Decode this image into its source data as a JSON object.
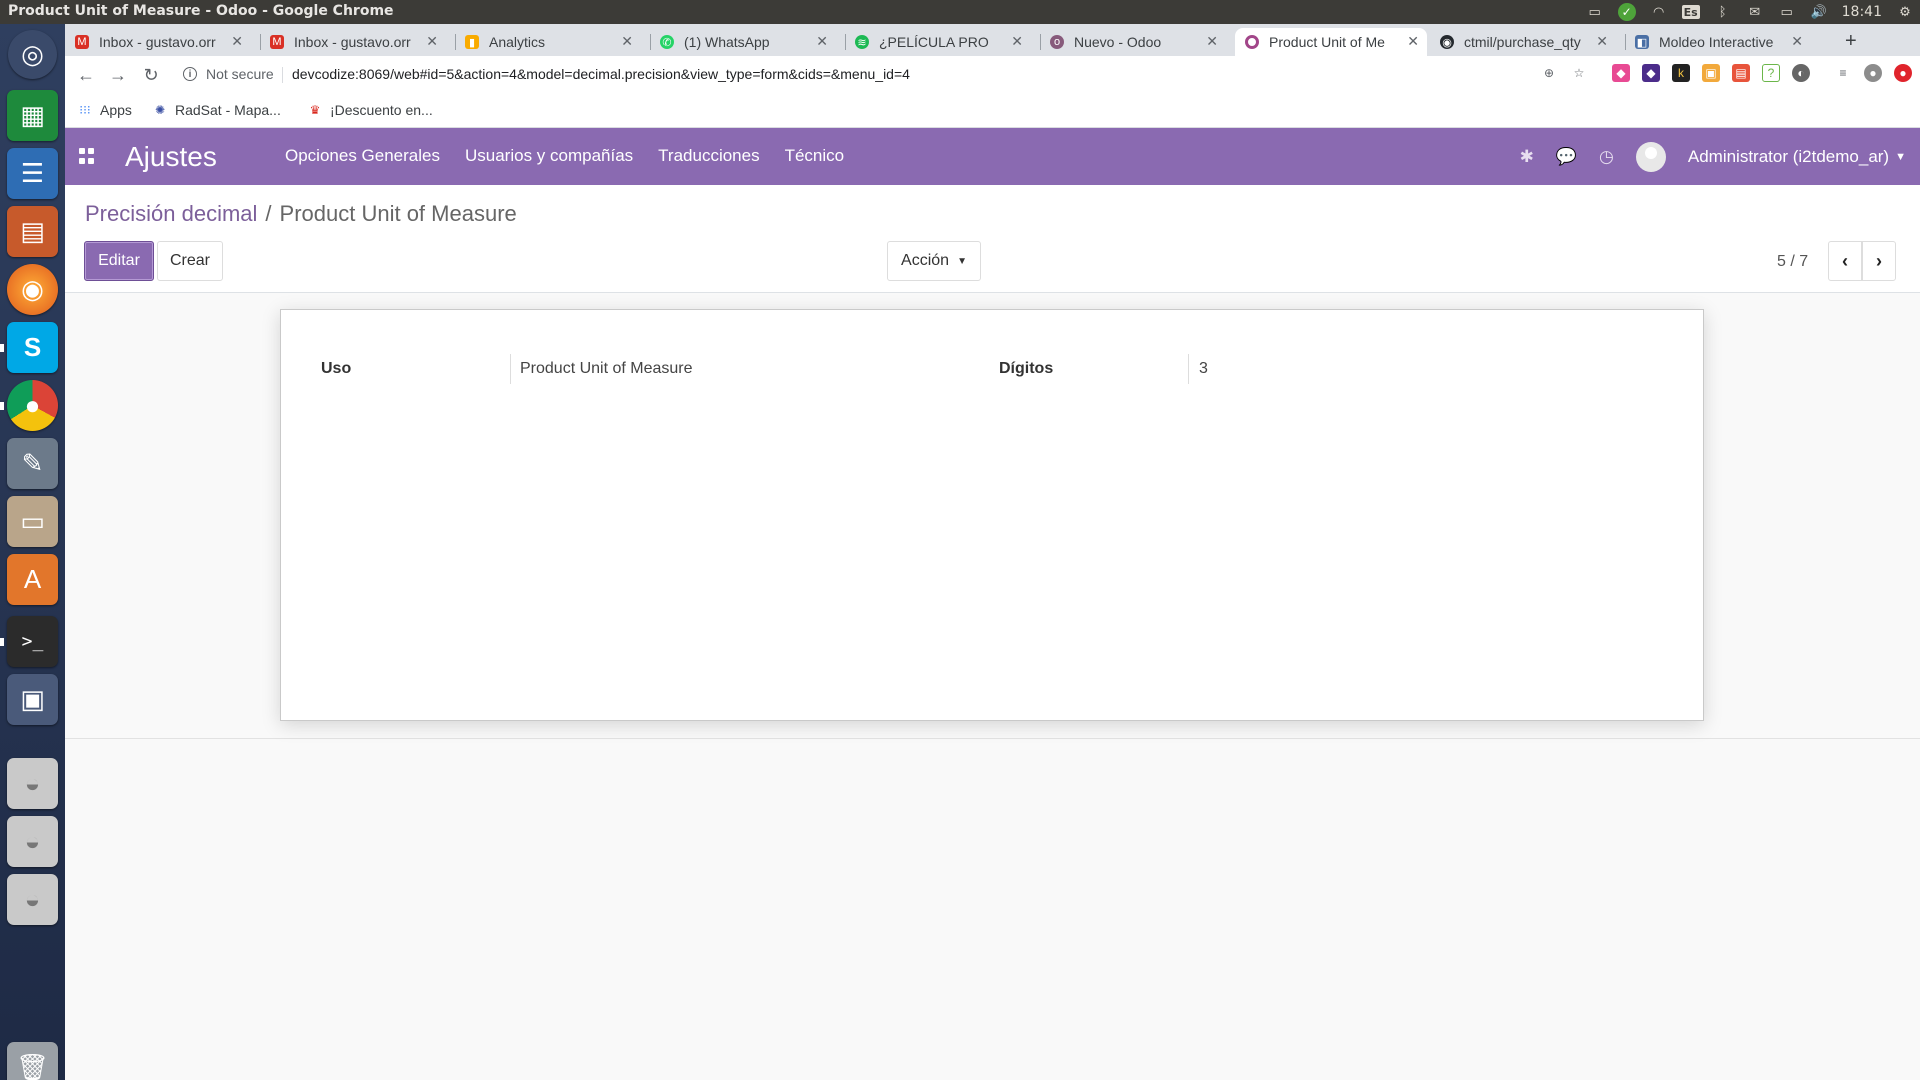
{
  "os": {
    "window_title": "Product Unit of Measure - Odoo - Google Chrome",
    "language": "Es",
    "clock": "18:41"
  },
  "browser": {
    "tabs": [
      {
        "label": "Inbox - gustavo.orr",
        "favicon": "gmail-icon",
        "color": "#d93025"
      },
      {
        "label": "Inbox - gustavo.orr",
        "favicon": "gmail-icon",
        "color": "#d93025"
      },
      {
        "label": "Analytics",
        "favicon": "analytics-icon",
        "color": "#f9ab00"
      },
      {
        "label": "(1) WhatsApp",
        "favicon": "whatsapp-icon",
        "color": "#25d366"
      },
      {
        "label": "¿PELÍCULA PRO",
        "favicon": "spotify-icon",
        "color": "#1db954"
      },
      {
        "label": "Nuevo - Odoo",
        "favicon": "odoo-icon",
        "color": "#875a7b"
      },
      {
        "label": "Product Unit of Me",
        "favicon": "odoo-icon",
        "color": "#a24689",
        "active": true
      },
      {
        "label": "ctmil/purchase_qty",
        "favicon": "github-icon",
        "color": "#24292e"
      },
      {
        "label": "Moldeo Interactive",
        "favicon": "moldeo-icon",
        "color": "#4a6fa5"
      }
    ],
    "security_label": "Not secure",
    "url": "devcodize:8069/web#id=5&action=4&model=decimal.precision&view_type=form&cids=&menu_id=4",
    "bookmarks": [
      {
        "label": "Apps",
        "icon": "apps-grid-icon"
      },
      {
        "label": "RadSat - Mapa...",
        "icon": "radsat-icon"
      },
      {
        "label": "¡Descuento en...",
        "icon": "discount-icon"
      }
    ]
  },
  "odoo": {
    "app_title": "Ajustes",
    "menu": [
      "Opciones Generales",
      "Usuarios y compañías",
      "Traducciones",
      "Técnico"
    ],
    "user": "Administrator (i2tdemo_ar)",
    "breadcrumb": {
      "parent": "Precisión decimal",
      "separator": "/",
      "current": "Product Unit of Measure"
    },
    "buttons": {
      "edit": "Editar",
      "create": "Crear",
      "action": "Acción"
    },
    "pager": "5 / 7",
    "form": {
      "usage_label": "Uso",
      "usage_value": "Product Unit of Measure",
      "digits_label": "Dígitos",
      "digits_value": "3"
    },
    "colors": {
      "brand": "#8a6ab1",
      "link": "#7c5f9a"
    }
  }
}
